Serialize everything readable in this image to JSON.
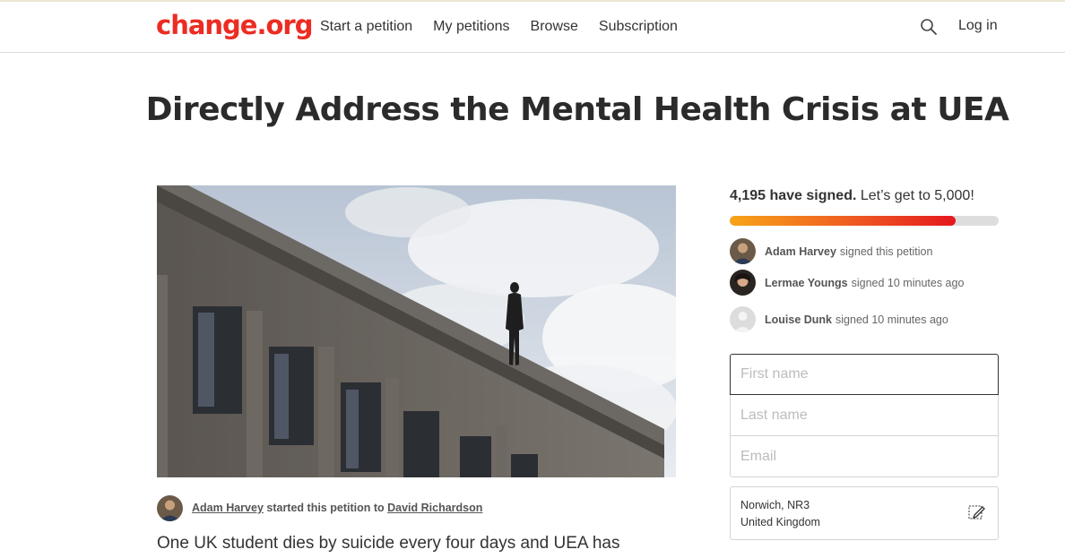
{
  "header": {
    "logo": "change.org",
    "nav": [
      "Start a petition",
      "My petitions",
      "Browse",
      "Subscription"
    ],
    "login": "Log in"
  },
  "petition": {
    "title": "Directly Address the Mental Health Crisis at UEA",
    "starter_name": "Adam Harvey",
    "starter_mid": " started this petition to ",
    "target_name": "David Richardson",
    "intro": "One UK student dies by suicide every four days and UEA has"
  },
  "signatures": {
    "count_bold": "4,195 have signed.",
    "goal_text": " Let’s get to 5,000!",
    "progress_fraction": 0.839,
    "recent": [
      {
        "name": "Adam Harvey",
        "action": "signed this petition"
      },
      {
        "name": "Lermae Youngs",
        "action": "signed 10 minutes ago"
      },
      {
        "name": "Louise Dunk",
        "action": "signed 10 minutes ago"
      }
    ]
  },
  "form": {
    "first_name_placeholder": "First name",
    "last_name_placeholder": "Last name",
    "email_placeholder": "Email",
    "location_line1": "Norwich, NR3",
    "location_line2": "United Kingdom"
  },
  "colors": {
    "brand": "#ec2c22",
    "progress_start": "#f7a418",
    "progress_end": "#e4181e"
  },
  "icons": {
    "search": "search-icon",
    "edit_location": "pencil-icon"
  }
}
